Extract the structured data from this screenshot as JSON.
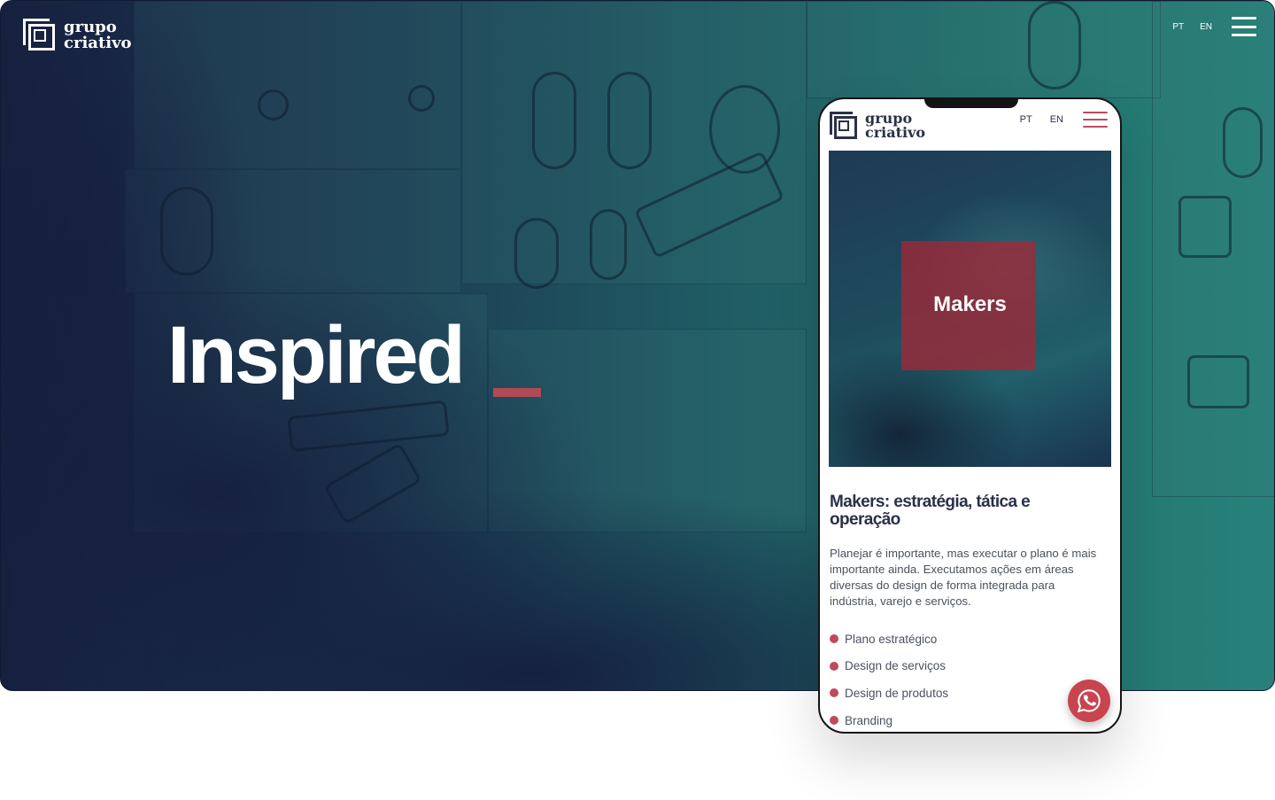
{
  "desktop": {
    "brand": {
      "line1": "grupo",
      "line2": "criativo"
    },
    "lang": [
      "PT",
      "EN"
    ],
    "headline": "Inspired"
  },
  "mobile": {
    "brand": {
      "line1": "grupo",
      "line2": "criativo"
    },
    "lang": [
      "PT",
      "EN"
    ],
    "hero_label": "Makers",
    "title": "Makers: estratégia, tática e operação",
    "body": "Planejar é importante, mas executar o plano é mais importante ainda. Executamos ações em áreas diversas do design de forma integrada para indústria, varejo e serviços.",
    "services": [
      "Plano estratégico",
      "Design de serviços",
      "Design de produtos",
      "Branding"
    ]
  },
  "colors": {
    "accent": "#c04a5b",
    "navy": "#2a3148",
    "teal": "#27817a",
    "dark_blue": "#17213f"
  },
  "icons": [
    "menu-icon",
    "whatsapp-icon",
    "logo-mark"
  ]
}
